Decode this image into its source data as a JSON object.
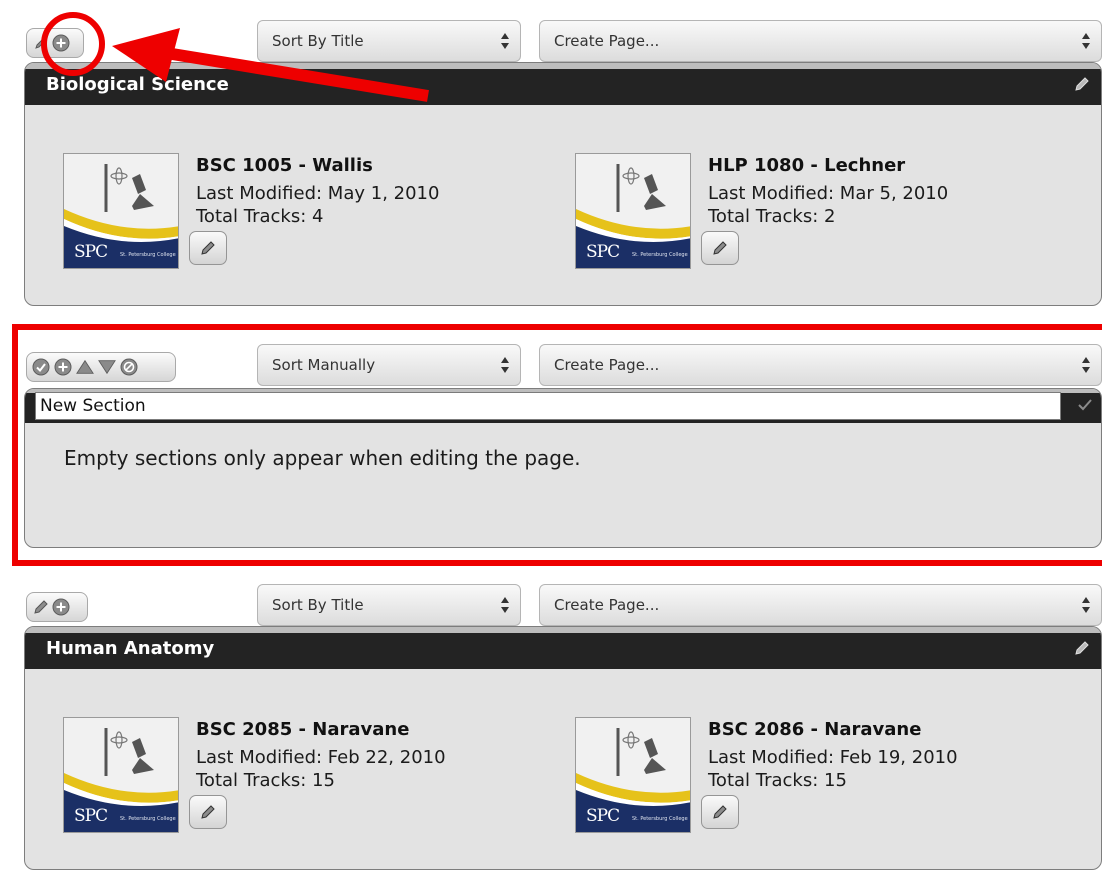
{
  "sections": [
    {
      "title": "Biological Science",
      "sort": {
        "selected": "Sort By Title"
      },
      "create_page": {
        "selected": "Create Page..."
      },
      "courses": [
        {
          "title": "BSC 1005 - Wallis",
          "modified": "Last Modified: May 1, 2010",
          "tracks": "Total Tracks: 4"
        },
        {
          "title": "HLP 1080 - Lechner",
          "modified": "Last Modified: Mar 5, 2010",
          "tracks": "Total Tracks: 2"
        }
      ]
    },
    {
      "sort": {
        "selected": "Sort Manually"
      },
      "create_page": {
        "selected": "Create Page..."
      },
      "name_field_value": "New Section",
      "empty_message": "Empty sections only appear when editing the page."
    },
    {
      "title": "Human Anatomy",
      "sort": {
        "selected": "Sort By Title"
      },
      "create_page": {
        "selected": "Create Page..."
      },
      "courses": [
        {
          "title": "BSC 2085 - Naravane",
          "modified": "Last Modified: Feb 22, 2010",
          "tracks": "Total Tracks: 15"
        },
        {
          "title": "BSC 2086 - Naravane",
          "modified": "Last Modified: Feb 19, 2010",
          "tracks": "Total Tracks: 15"
        }
      ]
    }
  ],
  "thumbnail": {
    "logo_text": "SPC",
    "logo_subtext": "St. Petersburg College"
  },
  "icons": {
    "edit": "pencil-icon",
    "add": "plus-circle-icon",
    "save": "check-circle-icon",
    "move_up": "triangle-up-icon",
    "move_down": "triangle-down-icon",
    "delete": "cancel-circle-icon",
    "select": "up-down-arrows-icon"
  },
  "colors": {
    "annotation": "#ee0000",
    "section_header": "#232323",
    "panel": "#e3e3e3"
  }
}
